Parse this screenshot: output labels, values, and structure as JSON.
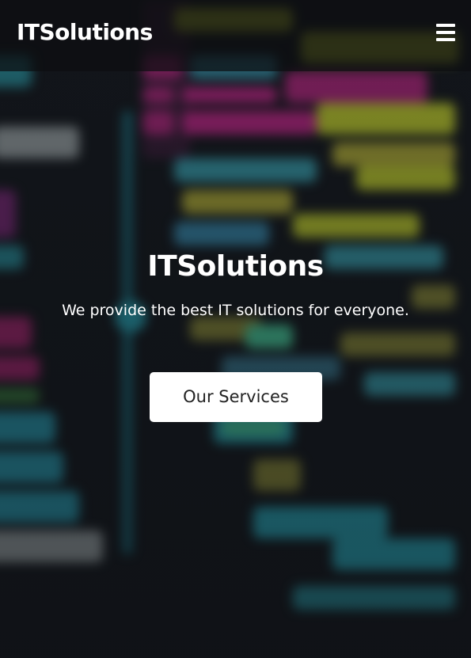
{
  "navbar": {
    "brand": "ITSolutions",
    "menu_icon": "hamburger-menu-icon"
  },
  "hero": {
    "title": "ITSolutions",
    "subtitle": "We provide the best IT solutions for everyone.",
    "cta_label": "Our Services"
  },
  "colors": {
    "text": "#ffffff",
    "button_bg": "#ffffff",
    "button_text": "#222222",
    "navbar_bg": "#0c0e10",
    "background": "#161a20",
    "code_magenta": "#c0288a",
    "code_teal": "#2aa6b8",
    "code_yellow": "#b9c22a",
    "code_green": "#3fb67a"
  }
}
